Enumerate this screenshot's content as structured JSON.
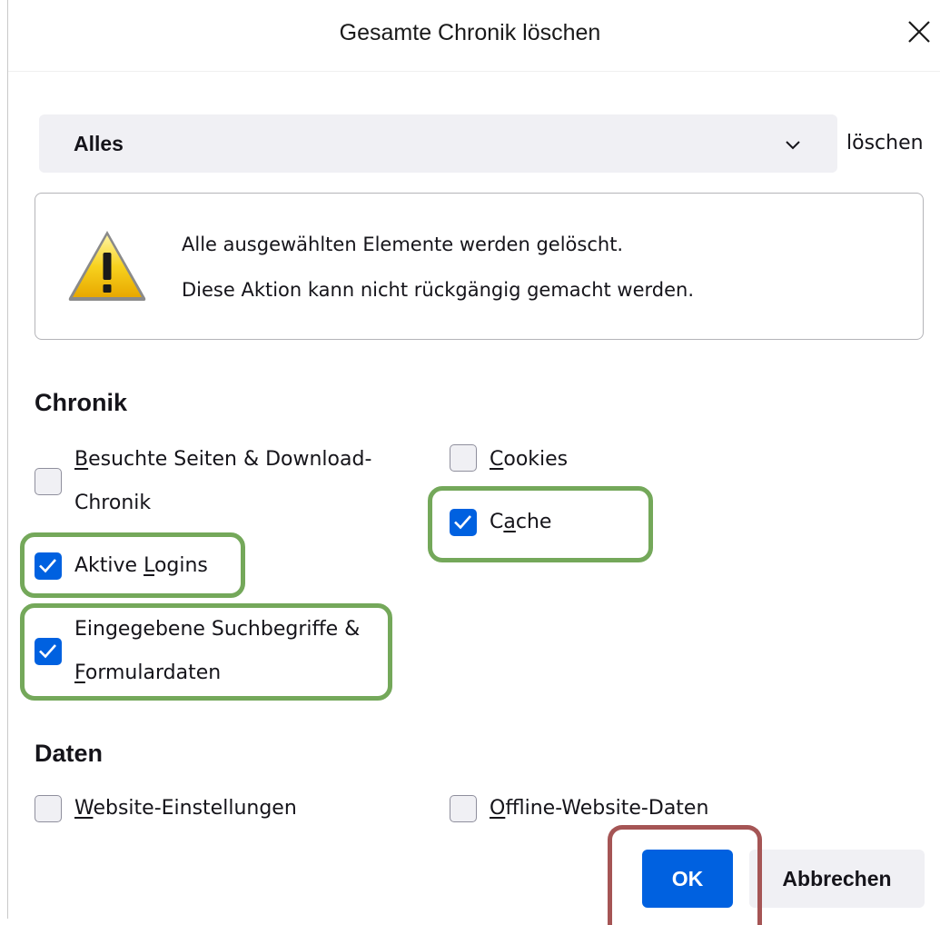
{
  "dialog": {
    "title": "Gesamte Chronik löschen",
    "close_icon": "close-icon"
  },
  "range": {
    "selected": "Alles",
    "suffix": "löschen",
    "chevron_icon": "chevron-down-icon"
  },
  "warning": {
    "icon": "warning-icon",
    "line1": "Alle ausgewählten Elemente werden gelöscht.",
    "line2": "Diese Aktion kann nicht rückgängig gemacht werden."
  },
  "history_section": {
    "heading": "Chronik",
    "items": [
      {
        "id": "history",
        "line1": "Besuchte Seiten & Download-",
        "line2": "Chronik",
        "access_key": "B",
        "checked": false
      },
      {
        "id": "cookies",
        "line1": "Cookies",
        "access_key": "C",
        "checked": false
      },
      {
        "id": "cache",
        "line1": "Cache",
        "access_key": "a",
        "checked": true
      },
      {
        "id": "logins",
        "line1": "Aktive Logins",
        "access_key": "L",
        "checked": true
      },
      {
        "id": "formdata",
        "line1": "Eingegebene Suchbegriffe &",
        "line2": "Formulardaten",
        "access_key": "F",
        "checked": true
      }
    ]
  },
  "data_section": {
    "heading": "Daten",
    "items": [
      {
        "id": "site-settings",
        "line1": "Website-Einstellungen",
        "access_key": "W",
        "checked": false
      },
      {
        "id": "offline-data",
        "line1": "Offline-Website-Daten",
        "access_key": "O",
        "checked": false
      }
    ]
  },
  "buttons": {
    "ok": "OK",
    "cancel": "Abbrechen"
  },
  "colors": {
    "accent": "#0061e0",
    "highlight_green": "#74a85a",
    "highlight_red": "#a55555"
  }
}
